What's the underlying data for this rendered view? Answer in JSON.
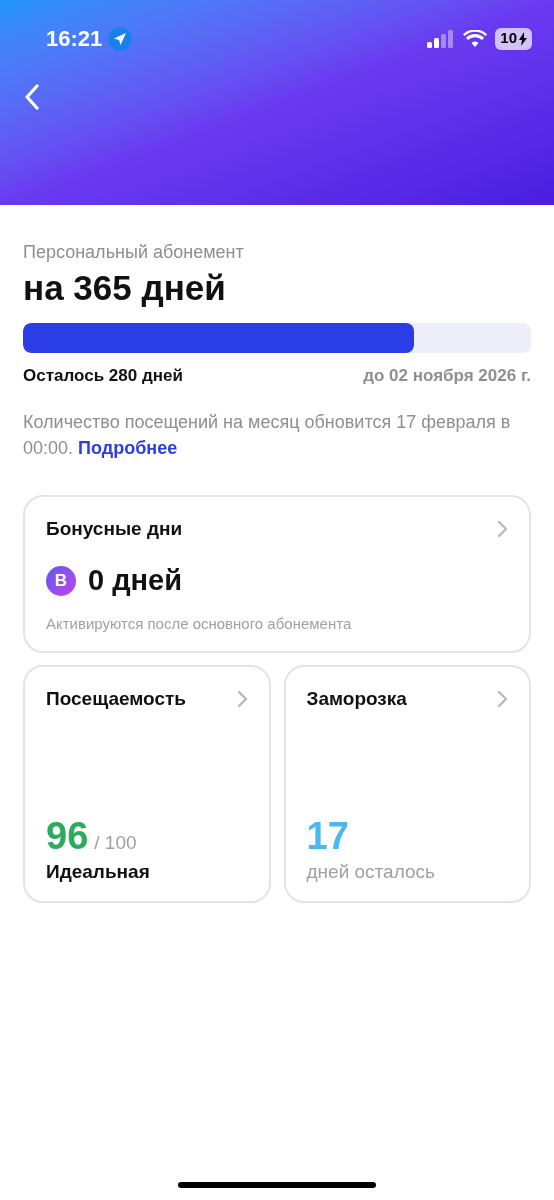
{
  "status_bar": {
    "time": "16:21",
    "battery": "10"
  },
  "subscription": {
    "label": "Персональный абонемент",
    "title": "на 365 дней",
    "level": 0.77,
    "remaining": "Осталось 280 дней",
    "until": "до 02 ноября 2026 г."
  },
  "notice": {
    "text": "Количество посещений на месяц обновится 17 февраля в 00:00.",
    "link": "Подробнее"
  },
  "bonus": {
    "title": "Бонусные дни",
    "badge": "B",
    "value": "0 дней",
    "caption": "Активируются после основного абонемента"
  },
  "tiles": [
    {
      "title": "Посещаемость",
      "value": "96",
      "suffix": "/ 100",
      "caption": "Идеальная",
      "color": "#2eaa5c",
      "kind": "score"
    },
    {
      "title": "Заморозка",
      "value": "17",
      "caption": "дней осталось",
      "color": "#4cb8f0",
      "kind": "counter"
    }
  ]
}
